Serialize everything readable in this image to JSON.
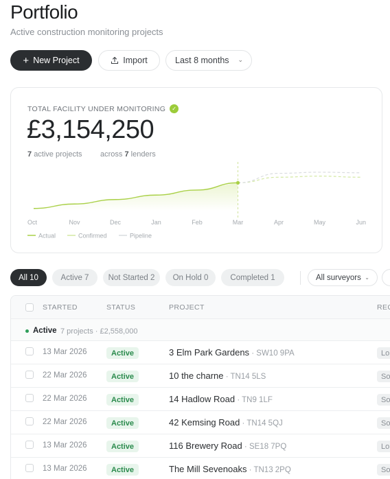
{
  "header": {
    "title": "Portfolio",
    "subtitle": "Active construction monitoring projects"
  },
  "toolbar": {
    "new_project_label": "New Project",
    "import_label": "Import",
    "date_range_label": "Last 8 months"
  },
  "summary": {
    "label": "TOTAL FACILITY UNDER MONITORING",
    "amount": "£3,154,250",
    "active_projects_count": "7",
    "active_projects_label": "active projects",
    "across_label": "across",
    "lenders_count": "7",
    "lenders_label": "lenders"
  },
  "chart_data": {
    "type": "line",
    "x": [
      "Oct",
      "Nov",
      "Dec",
      "Jan",
      "Feb",
      "Mar",
      "Apr",
      "May",
      "Jun"
    ],
    "series": [
      {
        "name": "Actual",
        "color": "#a9d046",
        "values": [
          0.2,
          0.6,
          1.0,
          1.4,
          1.85,
          2.5,
          null,
          null,
          null
        ]
      },
      {
        "name": "Confirmed",
        "color": "#d3e8a3",
        "values": [
          null,
          null,
          null,
          null,
          null,
          2.5,
          3.0,
          3.1,
          3.0
        ]
      },
      {
        "name": "Pipeline",
        "color": "#d9dcdf",
        "values": [
          null,
          null,
          null,
          null,
          null,
          2.5,
          3.35,
          3.45,
          3.4
        ]
      }
    ],
    "current_marker": "Mar",
    "ylim": [
      0,
      4.0
    ],
    "legend_position": "bottom-left",
    "grid": false
  },
  "filters": {
    "chips": [
      {
        "label": "All 10",
        "active": true
      },
      {
        "label": "Active 7",
        "active": false
      },
      {
        "label": "Not Started 2",
        "active": false
      },
      {
        "label": "On Hold 0",
        "active": false
      },
      {
        "label": "Completed 1",
        "active": false
      }
    ],
    "surveyor_select": "All surveyors"
  },
  "table": {
    "columns": [
      "STARTED",
      "STATUS",
      "PROJECT",
      "REG"
    ],
    "group": {
      "label": "Active",
      "meta": "7 projects · £2,558,000"
    },
    "rows": [
      {
        "started": "13 Mar 2026",
        "status": "Active",
        "project": "3 Elm Park Gardens",
        "postcode": "SW10 9PA",
        "region": "Lo"
      },
      {
        "started": "22 Mar 2026",
        "status": "Active",
        "project": "10 the charne",
        "postcode": "TN14 5LS",
        "region": "So"
      },
      {
        "started": "22 Mar 2026",
        "status": "Active",
        "project": "14 Hadlow Road",
        "postcode": "TN9 1LF",
        "region": "So"
      },
      {
        "started": "22 Mar 2026",
        "status": "Active",
        "project": "42 Kemsing Road",
        "postcode": "TN14 5QJ",
        "region": "So"
      },
      {
        "started": "13 Mar 2026",
        "status": "Active",
        "project": "116 Brewery Road",
        "postcode": "SE18 7PQ",
        "region": "Lo"
      },
      {
        "started": "13 Mar 2026",
        "status": "Active",
        "project": "The Mill Sevenoaks",
        "postcode": "TN13 2PQ",
        "region": "So"
      }
    ]
  }
}
